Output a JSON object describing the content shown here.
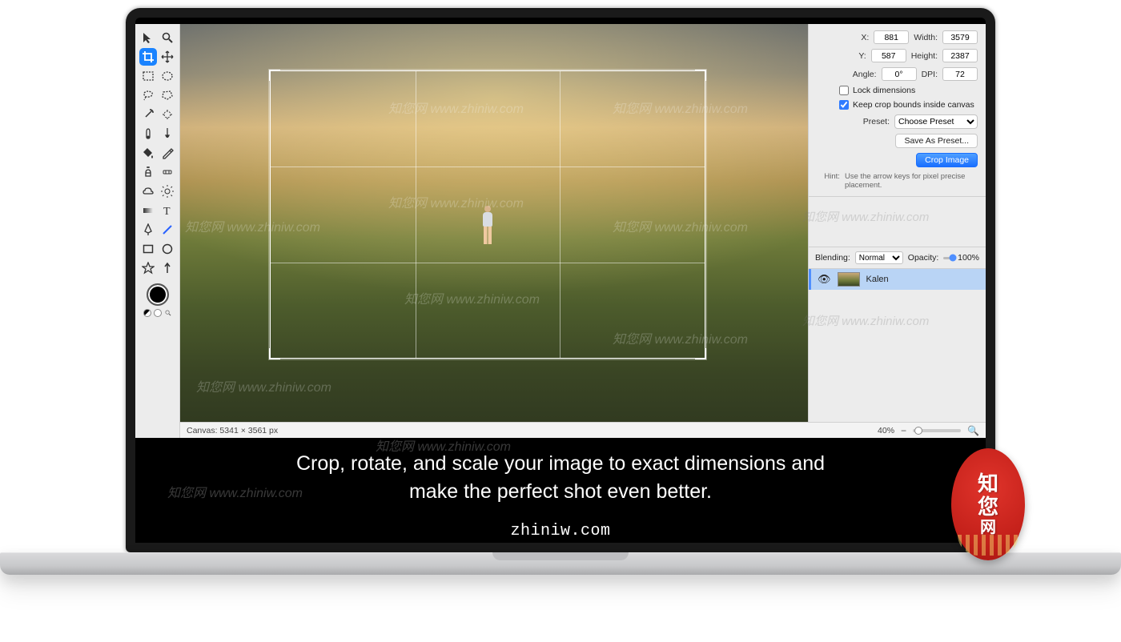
{
  "crop": {
    "x_label": "X:",
    "x": "881",
    "y_label": "Y:",
    "y": "587",
    "width_label": "Width:",
    "width": "3579",
    "height_label": "Height:",
    "height": "2387",
    "angle_label": "Angle:",
    "angle": "0°",
    "dpi_label": "DPI:",
    "dpi": "72",
    "lock_label": "Lock dimensions",
    "keep_bounds_label": "Keep crop bounds inside canvas",
    "preset_label": "Preset:",
    "preset_value": "Choose Preset",
    "save_preset_label": "Save As Preset...",
    "crop_image_label": "Crop Image",
    "hint_label": "Hint:",
    "hint_text": "Use the arrow keys for pixel precise placement."
  },
  "blending": {
    "label": "Blending:",
    "mode": "Normal",
    "opacity_label": "Opacity:",
    "opacity_value": "100%"
  },
  "layer": {
    "name": "Kalen"
  },
  "status": {
    "canvas_label": "Canvas: 5341 × 3561 px",
    "zoom": "40%"
  },
  "caption": {
    "line1": "Crop, rotate, and scale your image to exact dimensions and",
    "line2": "make the perfect shot even better.",
    "url": "zhiniw.com"
  },
  "seal": {
    "char1": "知",
    "char2": "您",
    "char3": "网"
  },
  "watermark": "知您网 www.zhiniw.com"
}
